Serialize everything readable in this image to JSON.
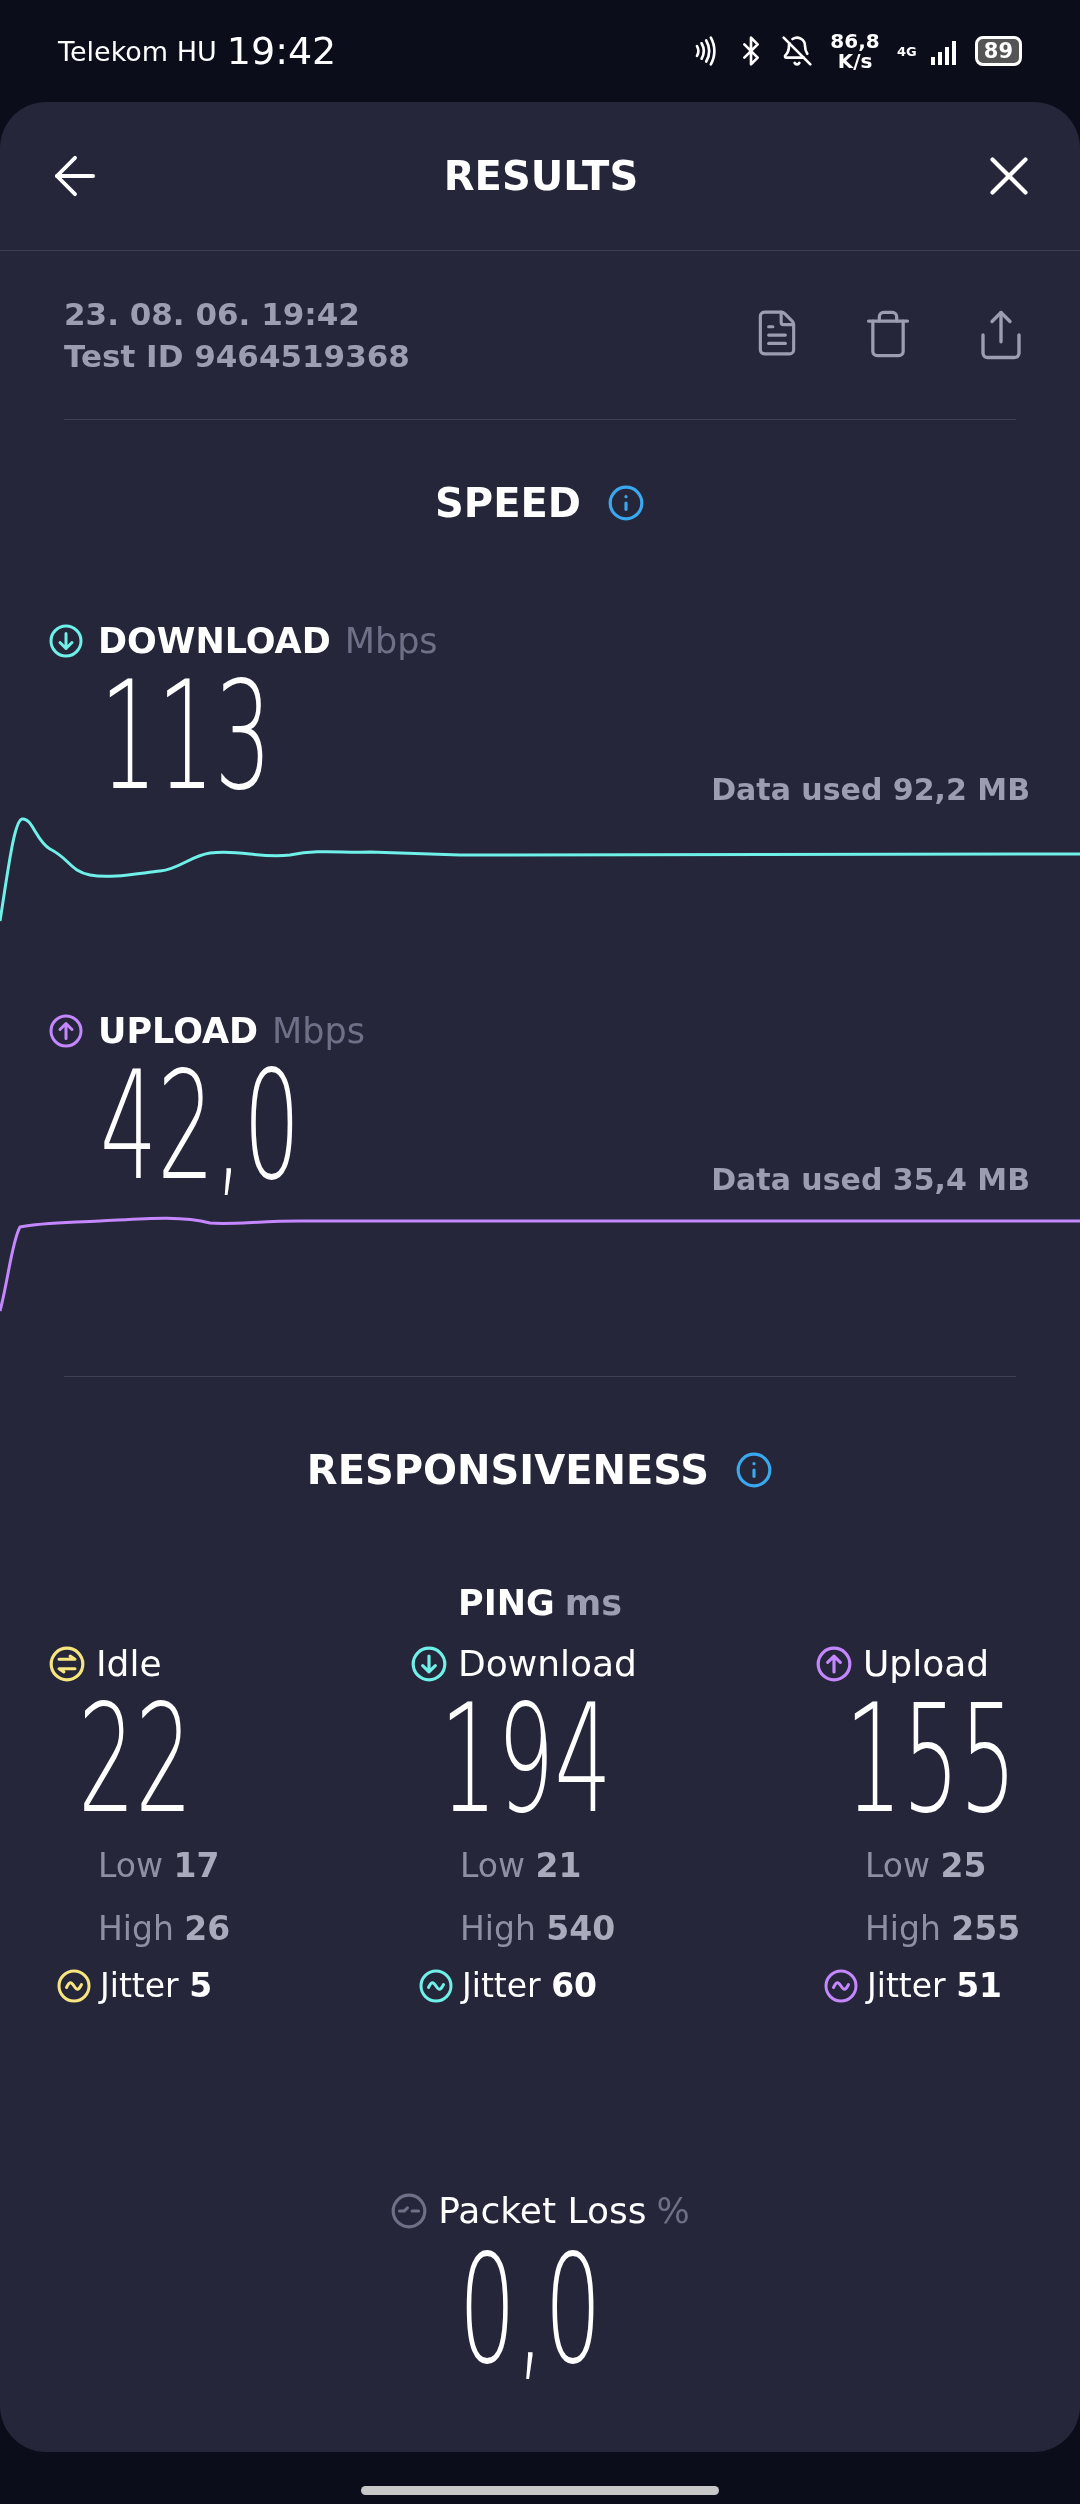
{
  "status_bar": {
    "carrier": "Telekom HU",
    "time": "19:42",
    "net_speed": "86,8",
    "net_unit": "K/s",
    "network": "4G",
    "battery": "89"
  },
  "header": {
    "title": "RESULTS"
  },
  "test": {
    "date": "23. 08. 06. 19:42",
    "id": "Test ID 9464519368"
  },
  "speed": {
    "title": "SPEED",
    "metrics": [
      {
        "kind": "download",
        "label": "DOWNLOAD",
        "unit": "Mbps",
        "value": "113",
        "data_used": "Data used 92,2 MB"
      },
      {
        "kind": "upload",
        "label": "UPLOAD",
        "unit": "Mbps",
        "value": "42,0",
        "data_used": "Data used 35,4 MB"
      }
    ]
  },
  "responsiveness": {
    "title": "RESPONSIVENESS",
    "ping_label": "PING",
    "ping_unit": "ms",
    "columns": [
      {
        "kind": "idle",
        "label": "Idle",
        "value": "22",
        "low": "Low **17**",
        "high": "High **26**",
        "jitter": "Jitter **5**"
      },
      {
        "kind": "download",
        "label": "Download",
        "value": "194",
        "low": "Low **21**",
        "high": "High **540**",
        "jitter": "Jitter **60**"
      },
      {
        "kind": "upload",
        "label": "Upload",
        "value": "155",
        "low": "Low **25**",
        "high": "High **255**",
        "jitter": "Jitter **51**"
      }
    ],
    "packet_loss": {
      "label": "Packet Loss",
      "unit": "%",
      "value": "0,0"
    }
  }
}
